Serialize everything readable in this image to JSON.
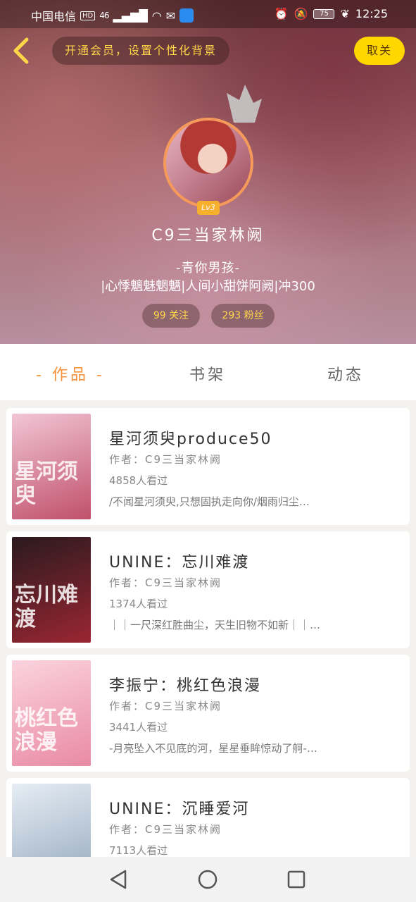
{
  "status_bar": {
    "carrier": "中国电信",
    "hd": "HD",
    "network": "46",
    "battery": "75",
    "time": "12:25"
  },
  "header": {
    "vip_banner": "开通会员，设置个性化背景",
    "cancel_label": "取关",
    "level": "Lv3",
    "username": "C9三当家林阙",
    "bio_line1": "-青你男孩-",
    "bio_line2": "|心悸魑魅魍魉|人间小甜饼阿阙|冲300",
    "follow": "99 关注",
    "fans": "293 粉丝"
  },
  "tabs": [
    {
      "label": "- 作品 -",
      "active": true
    },
    {
      "label": "书架",
      "active": false
    },
    {
      "label": "动态",
      "active": false
    }
  ],
  "works": [
    {
      "title": "星河须臾produce50",
      "author": "作者：C9三当家林阙",
      "views": "4858人看过",
      "desc": "/不闻星河须臾,只想固执走向你/烟雨归尘…",
      "cover_text": "星河须臾",
      "cover_color_a": "#f2c6d6",
      "cover_color_b": "#c0506a"
    },
    {
      "title": "UNINE：忘川难渡",
      "author": "作者：C9三当家林阙",
      "views": "1374人看过",
      "desc": "｜｜一尺深红胜曲尘，天生旧物不如新｜｜…",
      "cover_text": "忘川难渡",
      "cover_color_a": "#2a1a1f",
      "cover_color_b": "#9a2632"
    },
    {
      "title": "李振宁：桃红色浪漫",
      "author": "作者：C9三当家林阙",
      "views": "3441人看过",
      "desc": "-月亮坠入不见底的河，星星垂眸惊动了舸-…",
      "cover_text": "桃红色浪漫",
      "cover_color_a": "#fbd3df",
      "cover_color_b": "#e98aa4"
    },
    {
      "title": "UNINE：沉睡爱河",
      "author": "作者：C9三当家林阙",
      "views": "7113人看过",
      "desc": "",
      "cover_text": "",
      "cover_color_a": "#e6edf4",
      "cover_color_b": "#93a7bd"
    }
  ],
  "colors": {
    "accent": "#f5923a",
    "yellow": "#ffd600",
    "gold_text": "#ffd54a"
  }
}
